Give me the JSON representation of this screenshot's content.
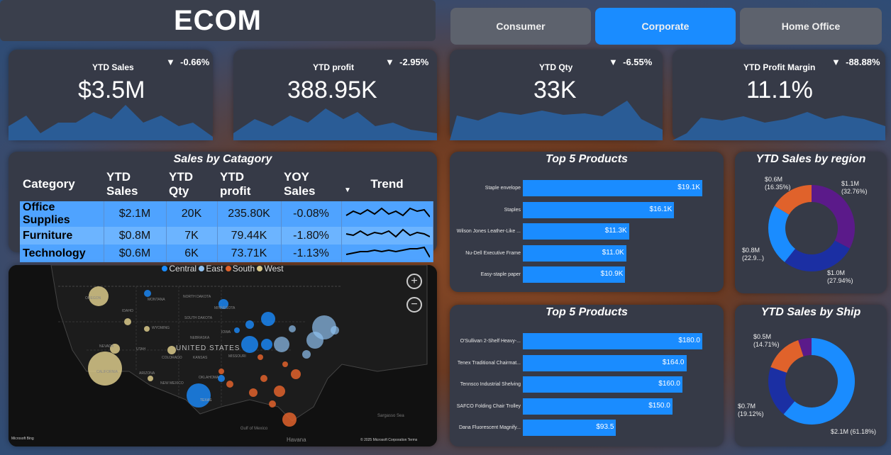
{
  "title": "ECOM",
  "segments": [
    {
      "label": "Consumer",
      "active": false
    },
    {
      "label": "Corporate",
      "active": true
    },
    {
      "label": "Home Office",
      "active": false
    }
  ],
  "kpis": [
    {
      "label": "YTD Sales",
      "value": "$3.5M",
      "delta": "-0.66%",
      "arrow": "▼"
    },
    {
      "label": "YTD profit",
      "value": "388.95K",
      "delta": "-2.95%",
      "arrow": "▼"
    },
    {
      "label": "YTD Qty",
      "value": "33K",
      "delta": "-6.55%",
      "arrow": "▼"
    },
    {
      "label": "YTD Profit Margin",
      "value": "11.1%",
      "delta": "-88.88%",
      "arrow": "▼"
    }
  ],
  "category_table": {
    "title": "Sales by Catagory",
    "headers": [
      "Category",
      "YTD Sales",
      "YTD Qty",
      "YTD profit",
      "YOY Sales",
      "Trend"
    ],
    "rows": [
      {
        "category": "Office Supplies",
        "sales": "$2.1M",
        "qty": "20K",
        "profit": "235.80K",
        "yoy": "-0.08%"
      },
      {
        "category": "Furniture",
        "sales": "$0.8M",
        "qty": "7K",
        "profit": "79.44K",
        "yoy": "-1.80%"
      },
      {
        "category": "Technology",
        "sales": "$0.6M",
        "qty": "6K",
        "profit": "73.71K",
        "yoy": "-1.13%"
      }
    ]
  },
  "map": {
    "legend": [
      {
        "name": "Central",
        "color": "#1a8cff"
      },
      {
        "name": "East",
        "color": "#8fc1f0"
      },
      {
        "name": "South",
        "color": "#e0622b"
      },
      {
        "name": "West",
        "color": "#d9c98a"
      }
    ],
    "country_label": "UNITED STATES",
    "state_labels": [
      "OREGON",
      "IDAHO",
      "NEVADA",
      "UTAH",
      "CALIFORNIA",
      "ARIZONA",
      "NEW MEXICO",
      "COLORADO",
      "WYOMING",
      "MONTANA",
      "NORTH DAKOTA",
      "SOUTH DAKOTA",
      "NEBRASKA",
      "KANSAS",
      "OKLAHOMA",
      "TEXAS",
      "MISSOURI",
      "IOWA",
      "MINNESOTA"
    ],
    "place_labels": [
      "Gulf of Mexico",
      "Havana",
      "Sargasso Sea"
    ],
    "attribution": "© 2025 Microsoft Corporation  Terms",
    "brand": "Microsoft Bing",
    "zoom_in": "+",
    "zoom_out": "−"
  },
  "top_products_1": {
    "title": "Top 5 Products",
    "items": [
      {
        "name": "Staple envelope",
        "value": 19.1,
        "label": "$19.1K"
      },
      {
        "name": "Staples",
        "value": 16.1,
        "label": "$16.1K"
      },
      {
        "name": "Wilson Jones Leather-Like ...",
        "value": 11.3,
        "label": "$11.3K"
      },
      {
        "name": "Nu-Dell Executive Frame",
        "value": 11.0,
        "label": "$11.0K"
      },
      {
        "name": "Easy-staple paper",
        "value": 10.9,
        "label": "$10.9K"
      }
    ]
  },
  "top_products_2": {
    "title": "Top 5 Products",
    "items": [
      {
        "name": "O'Sullivan 2-Shelf Heavy-...",
        "value": 180.0,
        "label": "$180.0"
      },
      {
        "name": "Tenex Traditional Chairmat...",
        "value": 164.0,
        "label": "$164.0"
      },
      {
        "name": "Tennsco Industrial Shelving",
        "value": 160.0,
        "label": "$160.0"
      },
      {
        "name": "SAFCO Folding Chair Trolley",
        "value": 150.0,
        "label": "$150.0"
      },
      {
        "name": "Dana Fluorescent Magnify...",
        "value": 93.5,
        "label": "$93.5"
      }
    ]
  },
  "region_donut": {
    "title": "YTD Sales by region",
    "slices": [
      {
        "value": 32.76,
        "color": "#5b1a8a",
        "l1": "$1.1M",
        "l2": "(32.76%)"
      },
      {
        "value": 27.94,
        "color": "#1b2fa3",
        "l1": "$1.0M",
        "l2": "(27.94%)"
      },
      {
        "value": 22.95,
        "color": "#1a8cff",
        "l1": "$0.8M",
        "l2": "(22.9...)"
      },
      {
        "value": 16.35,
        "color": "#e0622b",
        "l1": "$0.6M",
        "l2": "(16.35%)"
      }
    ]
  },
  "ship_donut": {
    "title": "YTD Sales by Ship",
    "slices": [
      {
        "value": 61.18,
        "color": "#1a8cff",
        "l1": "$2.1M (61.18%)",
        "l2": ""
      },
      {
        "value": 19.12,
        "color": "#1b2fa3",
        "l1": "$0.7M",
        "l2": "(19.12%)"
      },
      {
        "value": 14.71,
        "color": "#e0622b",
        "l1": "$0.5M",
        "l2": "(14.71%)"
      },
      {
        "value": 4.99,
        "color": "#5b1a8a",
        "l1": "",
        "l2": ""
      }
    ]
  }
}
